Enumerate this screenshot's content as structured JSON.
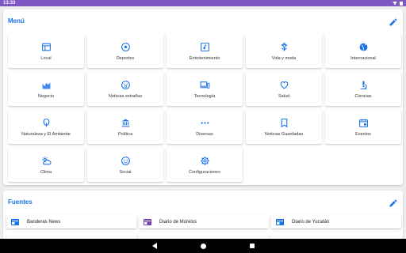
{
  "status": {
    "time": "13:33"
  },
  "menu": {
    "title": "Menú",
    "items": [
      {
        "label": "Local",
        "icon": "newspaper-icon"
      },
      {
        "label": "Deportes",
        "icon": "soccer-ball-icon"
      },
      {
        "label": "Entretenimiento",
        "icon": "music-note-icon"
      },
      {
        "label": "Vida y moda",
        "icon": "flower-icon"
      },
      {
        "label": "Internacional",
        "icon": "globe-icon"
      },
      {
        "label": "Negocio",
        "icon": "chart-icon"
      },
      {
        "label": "Noticias extrañas",
        "icon": "surprised-face-icon"
      },
      {
        "label": "Tecnología",
        "icon": "devices-icon"
      },
      {
        "label": "Salud",
        "icon": "heart-icon"
      },
      {
        "label": "Ciencias",
        "icon": "microscope-icon"
      },
      {
        "label": "Naturaleza y El Ambiente",
        "icon": "tree-icon"
      },
      {
        "label": "Política",
        "icon": "institution-icon"
      },
      {
        "label": "Diversas",
        "icon": "more-dots-icon"
      },
      {
        "label": "Noticias Guardadas",
        "icon": "bookmark-icon"
      },
      {
        "label": "Eventos",
        "icon": "calendar-icon"
      },
      {
        "label": "Clima",
        "icon": "weather-icon"
      },
      {
        "label": "Social",
        "icon": "smiley-icon"
      },
      {
        "label": "Configuraciones",
        "icon": "gear-icon"
      }
    ]
  },
  "sources": {
    "title": "Fuentes",
    "items": [
      {
        "label": "Banderas News",
        "icon": "source-logo-icon",
        "color": "#1a73e8"
      },
      {
        "label": "Diario de Morelos",
        "icon": "source-logo-icon",
        "color": "#7b3fb5"
      },
      {
        "label": "Diario de Yucatán",
        "icon": "source-logo-icon",
        "color": "#1a73e8"
      }
    ]
  },
  "colors": {
    "accent": "#1a73e8",
    "statusbar": "#7e57c2"
  }
}
